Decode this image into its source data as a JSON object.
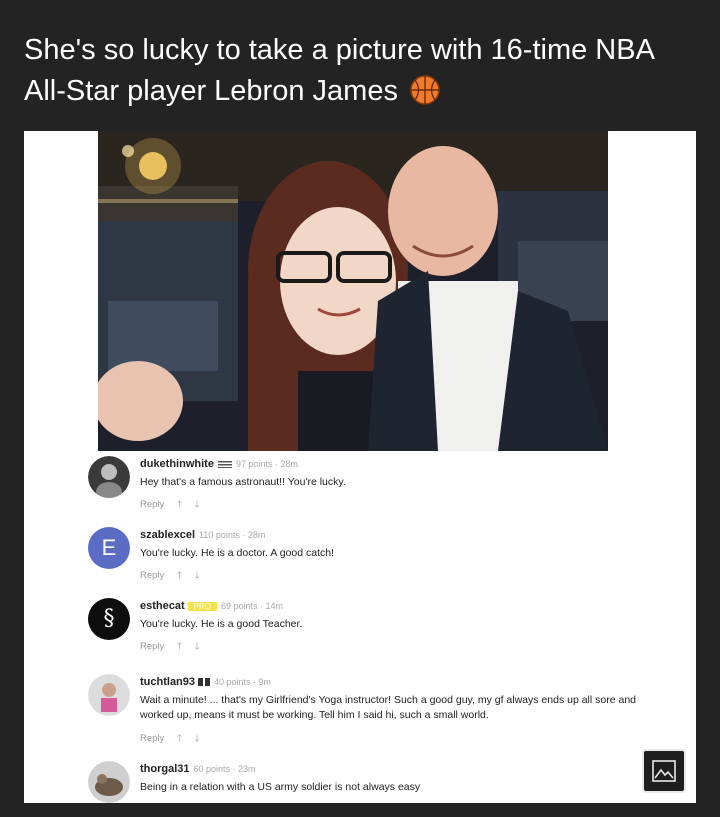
{
  "post": {
    "title": "She's so lucky to take a picture with 16-time NBA All-Star player Lebron James",
    "title_icon": "basketball-emoji"
  },
  "comments": [
    {
      "username": "dukethinwhite",
      "points": "97 points · 28m",
      "text": "Hey that's a famous astronaut!! You're lucky.",
      "reply": "Reply",
      "avatar": "photo"
    },
    {
      "username": "szablexcel",
      "points": "110 points · 28m",
      "text": "You're lucky. He is a doctor. A good catch!",
      "reply": "Reply",
      "avatar_letter": "E"
    },
    {
      "username": "esthecat",
      "badge": "PRO",
      "points": "69 points · 14m",
      "text": "You're lucky. He is a good Teacher.",
      "reply": "Reply",
      "avatar_letter": "§"
    },
    {
      "username": "tuchtlan93",
      "points": "40 points · 9m",
      "text": "Wait a minute! ... that's my Girlfriend's Yoga instructor! Such a good guy, my gf always ends up all sore and worked up, means it must be working. Tell him I said hi, such a small world.",
      "reply": "Reply",
      "avatar": "photo"
    },
    {
      "username": "thorgal31",
      "points": "60 points · 23m",
      "text": "Being in a relation with a US army soldier is not always easy",
      "avatar": "photo"
    }
  ],
  "ui": {
    "gallery_icon": "image-gallery-icon"
  }
}
